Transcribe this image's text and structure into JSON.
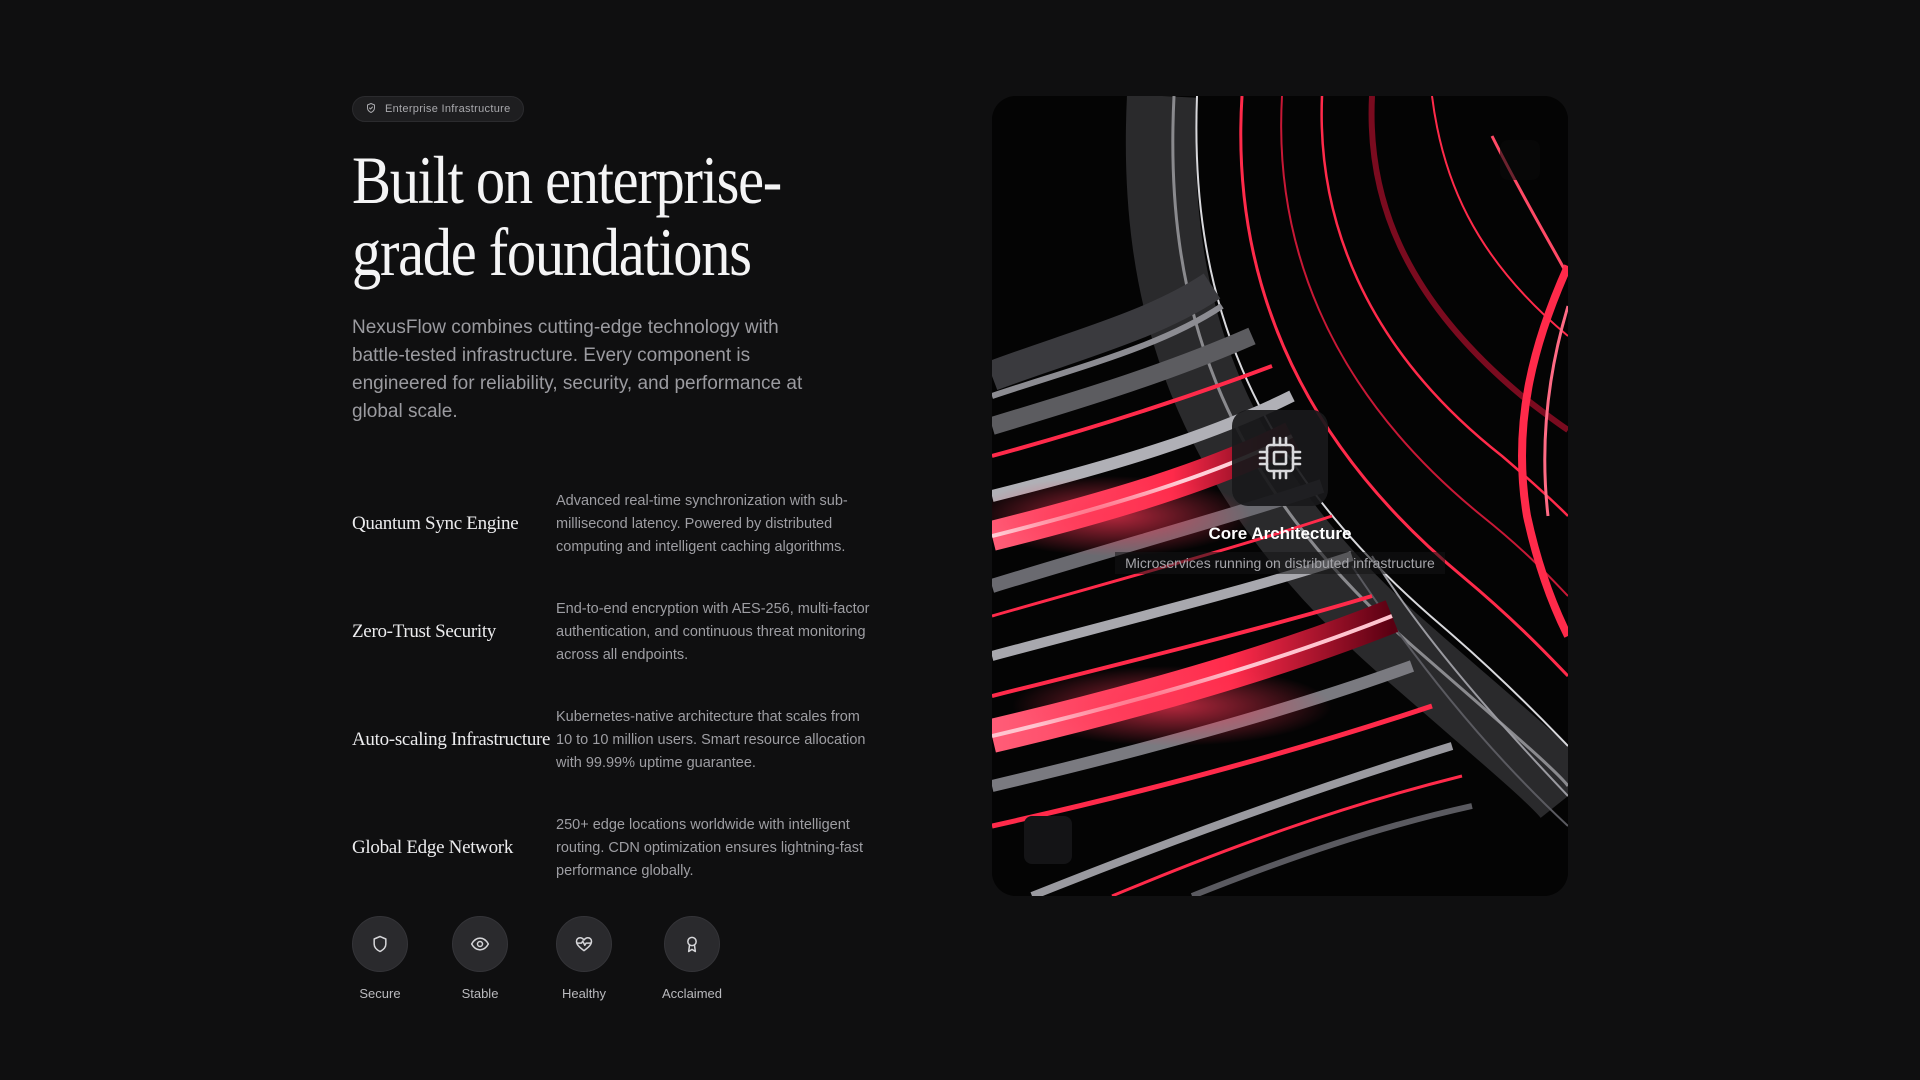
{
  "badge": {
    "label": "Enterprise Infrastructure",
    "icon": "shield-check-icon"
  },
  "hero": {
    "headline_line1": "Built on enterprise-",
    "headline_line2": "grade foundations",
    "intro": "NexusFlow combines cutting-edge technology with battle-tested infrastructure. Every component is engineered for reliability, security, and performance at global scale."
  },
  "features": [
    {
      "title": "Quantum Sync Engine",
      "description": "Advanced real-time synchronization with sub-millisecond latency. Powered by distributed computing and intelligent caching algorithms."
    },
    {
      "title": "Zero-Trust Security",
      "description": "End-to-end encryption with AES-256, multi-factor authentication, and continuous threat monitoring across all endpoints."
    },
    {
      "title": "Auto-scaling Infrastructure",
      "description": "Kubernetes-native architecture that scales from 10 to 10 million users. Smart resource allocation with 99.99% uptime guarantee."
    },
    {
      "title": "Global Edge Network",
      "description": "250+ edge locations worldwide with intelligent routing. CDN optimization ensures lightning-fast performance globally."
    }
  ],
  "trust": [
    {
      "label": "Secure",
      "icon": "shield-icon"
    },
    {
      "label": "Stable",
      "icon": "eye-icon"
    },
    {
      "label": "Healthy",
      "icon": "heart-pulse-icon"
    },
    {
      "label": "Acclaimed",
      "icon": "award-icon"
    }
  ],
  "card": {
    "title": "Core Architecture",
    "subtitle": "Microservices running on distributed infrastructure",
    "icon": "cpu-icon"
  },
  "colors": {
    "background": "#0f0f10",
    "accent_red": "#ff2a4a",
    "text_primary": "#f4f4f5",
    "text_muted": "#9b9ba0"
  }
}
